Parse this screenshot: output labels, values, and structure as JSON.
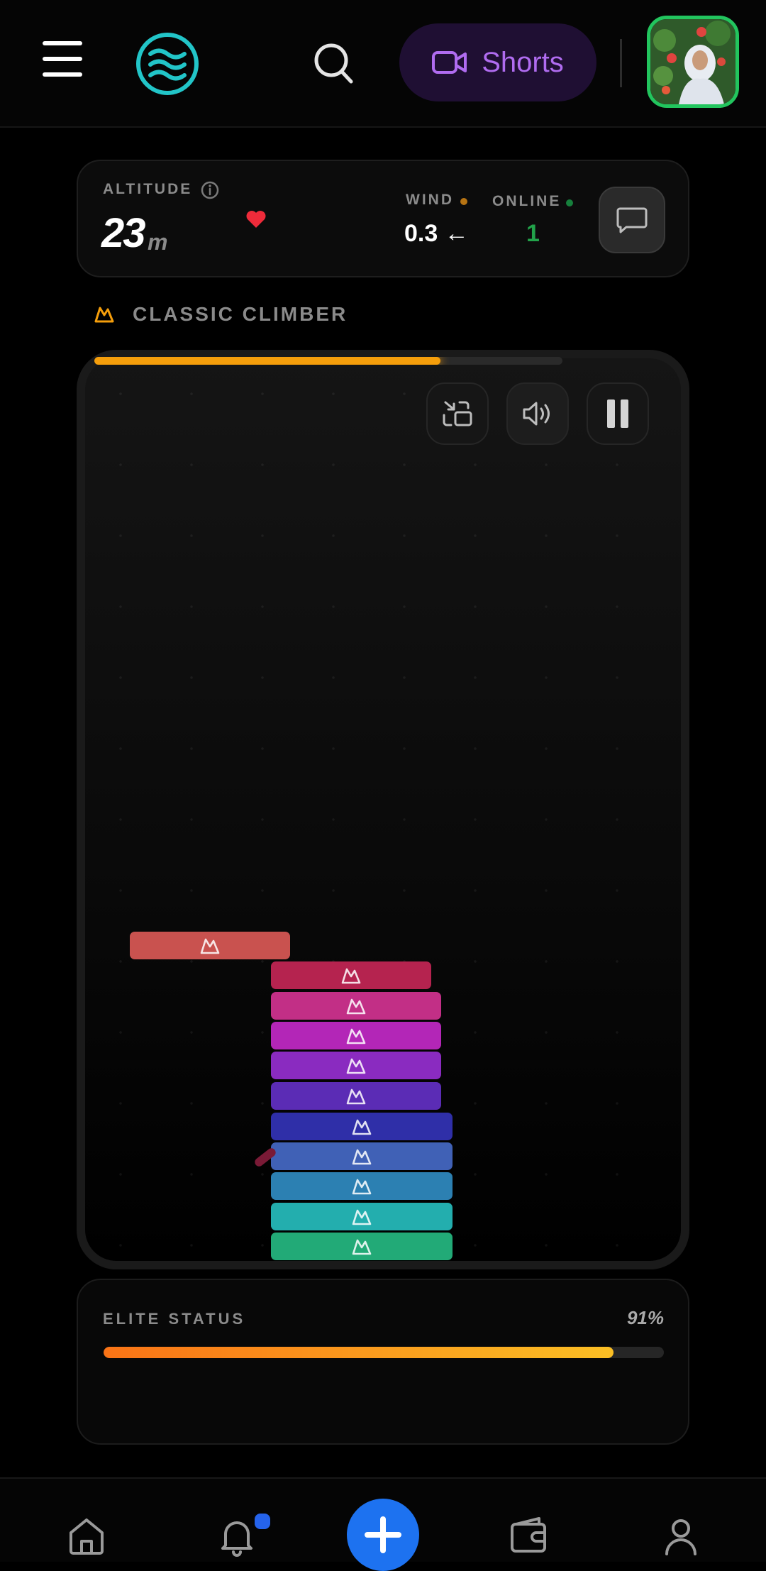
{
  "header": {
    "shorts_label": "Shorts",
    "icons": [
      "menu-icon",
      "waves-logo-icon",
      "search-icon",
      "video-camera-icon",
      "avatar-photo"
    ]
  },
  "stats": {
    "altitude_label": "ALTITUDE",
    "altitude_value": "23",
    "altitude_unit": "m",
    "wind_label": "WIND",
    "wind_value": "0.3 ←",
    "online_label": "ONLINE",
    "online_value": "1",
    "icons": [
      "info-icon",
      "heart-icon",
      "chat-icon"
    ]
  },
  "game": {
    "mode_label": "CLASSIC CLIMBER",
    "level_progress": 0.74,
    "controls": [
      "swap-icon",
      "volume-icon",
      "pause-icon"
    ],
    "blocks": [
      {
        "color": "#c9524f"
      },
      {
        "color": "#b5234f"
      },
      {
        "color": "#c22f86"
      },
      {
        "color": "#b326b7"
      },
      {
        "color": "#8a2bc0"
      },
      {
        "color": "#5b2cb5"
      },
      {
        "color": "#2f2fa8"
      },
      {
        "color": "#4061b6"
      },
      {
        "color": "#2c80b2"
      },
      {
        "color": "#23aeae"
      },
      {
        "color": "#22aa77"
      }
    ]
  },
  "elite": {
    "label": "ELITE STATUS",
    "percent_label": "91%",
    "progress": 0.91
  },
  "nav": {
    "items": [
      "home-icon",
      "bell-icon",
      "add-icon",
      "wallet-icon",
      "profile-icon"
    ],
    "accent": "#1d72f0"
  }
}
